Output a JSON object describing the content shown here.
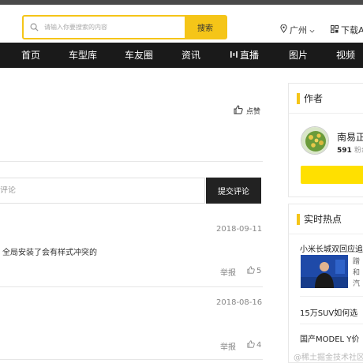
{
  "header": {
    "search_placeholder": "请输入你要搜索的内容",
    "search_button": "搜索",
    "location": "广州",
    "download": "下载A"
  },
  "nav": {
    "items": [
      {
        "label": "首页"
      },
      {
        "label": "车型库"
      },
      {
        "label": "车友圈"
      },
      {
        "label": "资讯"
      },
      {
        "label": "直播"
      },
      {
        "label": "图片"
      },
      {
        "label": "视频"
      }
    ]
  },
  "article": {
    "like_label": "点赞"
  },
  "comment_form": {
    "placeholder": "评论",
    "submit_label": "提交评论"
  },
  "comments": [
    {
      "date": "2018-09-11",
      "text": "全局安装了会有样式冲突的",
      "report": "举报",
      "likes": "5"
    },
    {
      "date": "2018-08-16",
      "text": "",
      "report": "举报",
      "likes": "4"
    }
  ],
  "sidebar": {
    "author_title": "作者",
    "author_name": "南易正",
    "author_count": "591",
    "author_count_label": "粉丝",
    "hot_title": "实时热点",
    "hot_items": [
      {
        "title": "小米长城双回应追"
      },
      {
        "title": "15万SUV如何选"
      },
      {
        "title": "国产MODEL Y价"
      }
    ],
    "hot_snippets": [
      "蹭",
      "和",
      "汽"
    ]
  },
  "watermark": "@稀土掘金技术社区",
  "colors": {
    "accent": "#f5c518",
    "follow": "#ffe000",
    "nav_bg": "#1a1a1a",
    "submit_bg": "#222222"
  }
}
